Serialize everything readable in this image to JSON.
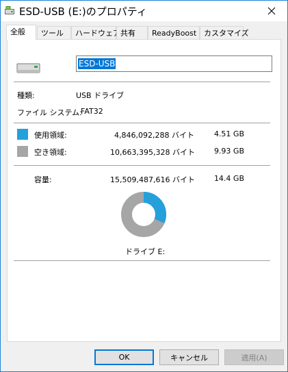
{
  "window": {
    "title": "ESD-USB (E:)のプロパティ",
    "close_glyph": "✕"
  },
  "tabs": [
    {
      "label": "全般",
      "active": true
    },
    {
      "label": "ツール",
      "active": false
    },
    {
      "label": "ハードウェア",
      "active": false
    },
    {
      "label": "共有",
      "active": false
    },
    {
      "label": "ReadyBoost",
      "active": false
    },
    {
      "label": "カスタマイズ",
      "active": false
    }
  ],
  "general": {
    "volume_name": "ESD-USB",
    "type_label": "種類:",
    "type_value": "USB ドライブ",
    "fs_label": "ファイル システム:",
    "fs_value": "FAT32",
    "used_label": "使用領域:",
    "used_bytes": "4,846,092,288 バイト",
    "used_size": "4.51 GB",
    "free_label": "空き領域:",
    "free_bytes": "10,663,395,328 バイト",
    "free_size": "9.93 GB",
    "capacity_label": "容量:",
    "capacity_bytes": "15,509,487,616 バイト",
    "capacity_size": "14.4 GB",
    "drive_label": "ドライブ E:",
    "used_fraction": 0.3125,
    "used_color": "#26a0da",
    "free_color": "#a6a6a6"
  },
  "buttons": {
    "ok": "OK",
    "cancel": "キャンセル",
    "apply": "適用(A)"
  }
}
